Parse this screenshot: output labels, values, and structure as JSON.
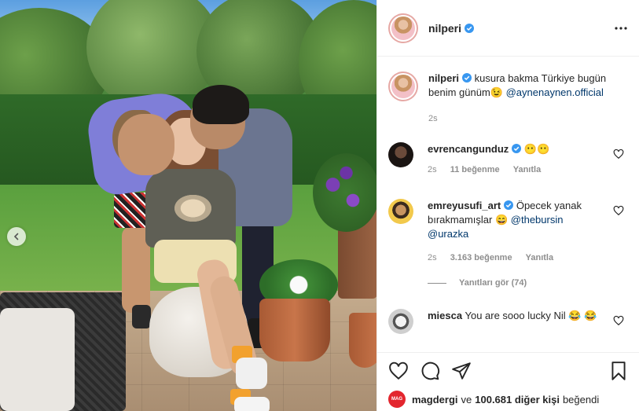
{
  "post": {
    "username": "nilperi",
    "caption_text": "kusura bakma Türkiye bugün benim günüm😉",
    "caption_mention": "@aynenaynen.official",
    "caption_time": "2s"
  },
  "comments": [
    {
      "username": "evrencangunduz",
      "text": "😶😶",
      "time": "2s",
      "likes": "11 beğenme",
      "reply_label": "Yanıtla"
    },
    {
      "username": "emreyusufi_art",
      "text": "Öpecek yanak bırakmamışlar 😄",
      "mentions": [
        "@thebursin",
        "@urazka"
      ],
      "time": "2s",
      "likes": "3.163 beğenme",
      "reply_label": "Yanıtla",
      "view_replies": "Yanıtları gör (74)"
    },
    {
      "username": "miesca",
      "text": "You are sooo lucky Nil 😂 😂"
    }
  ],
  "likes_summary": {
    "liker": "magdergi",
    "conjunction": "ve",
    "count_text": "100.681 diğer kişi",
    "suffix": "beğendi",
    "liker_avatar_text": "MAG"
  },
  "colors": {
    "link": "#00376b",
    "muted": "#8e8e8e",
    "verified": "#3897f0",
    "border": "#efefef"
  },
  "icons": [
    "chevron-left-icon",
    "verified-icon",
    "more-icon",
    "heart-icon",
    "comment-icon",
    "share-icon",
    "bookmark-icon"
  ]
}
